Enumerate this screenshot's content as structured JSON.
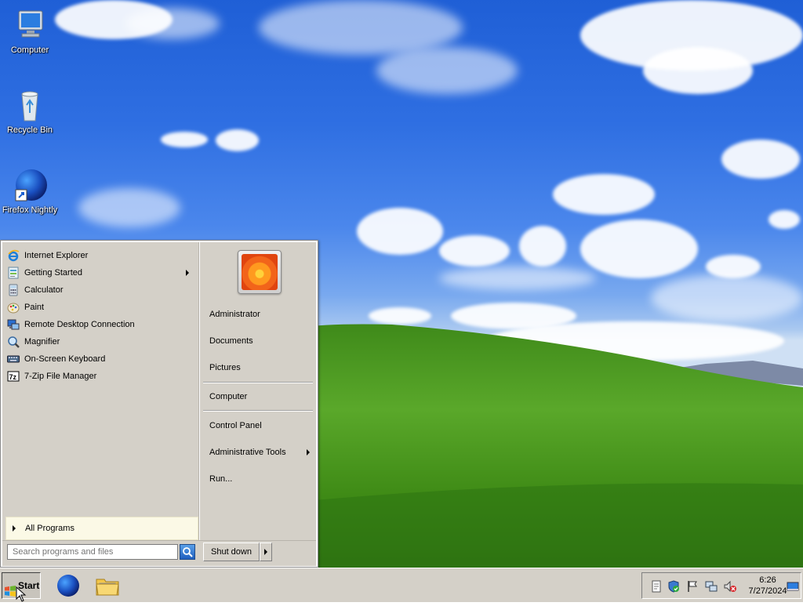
{
  "desktop": {
    "icons": [
      {
        "label": "Computer",
        "icon": "computer-icon"
      },
      {
        "label": "Recycle Bin",
        "icon": "recycle-bin-icon"
      },
      {
        "label": "Firefox Nightly",
        "icon": "firefox-nightly-icon"
      }
    ]
  },
  "start_menu": {
    "programs": [
      {
        "label": "Internet Explorer",
        "icon": "internet-explorer-icon"
      },
      {
        "label": "Getting Started",
        "icon": "getting-started-icon",
        "has_submenu": true
      },
      {
        "label": "Calculator",
        "icon": "calculator-icon"
      },
      {
        "label": "Paint",
        "icon": "paint-icon"
      },
      {
        "label": "Remote Desktop Connection",
        "icon": "remote-desktop-icon"
      },
      {
        "label": "Magnifier",
        "icon": "magnifier-icon"
      },
      {
        "label": "On-Screen Keyboard",
        "icon": "keyboard-icon"
      },
      {
        "label": "7-Zip File Manager",
        "icon": "7zip-icon"
      }
    ],
    "all_programs": "All Programs",
    "search_placeholder": "Search programs and files",
    "right_items": [
      {
        "label": "Administrator"
      },
      {
        "label": "Documents"
      },
      {
        "label": "Pictures"
      },
      {
        "label": "Computer"
      },
      {
        "label": "Control Panel"
      },
      {
        "label": "Administrative Tools",
        "has_submenu": true
      },
      {
        "label": "Run..."
      }
    ],
    "shutdown_label": "Shut down"
  },
  "taskbar": {
    "start_label": "Start",
    "pinned": [
      {
        "icon": "firefox-nightly-icon"
      },
      {
        "icon": "file-explorer-icon"
      }
    ],
    "tray_icons": [
      "action-center-icon",
      "security-shield-icon",
      "flag-icon",
      "network-icon",
      "volume-muted-icon"
    ],
    "clock_time": "6:26",
    "clock_date": "7/27/2024",
    "show_desktop_icon": "show-desktop-icon"
  },
  "colors": {
    "sky_top": "#1f5fd6",
    "grass": "#4f9a1f",
    "menu_bg": "#d4d0c8",
    "all_programs_bg": "#fbf9e6"
  }
}
